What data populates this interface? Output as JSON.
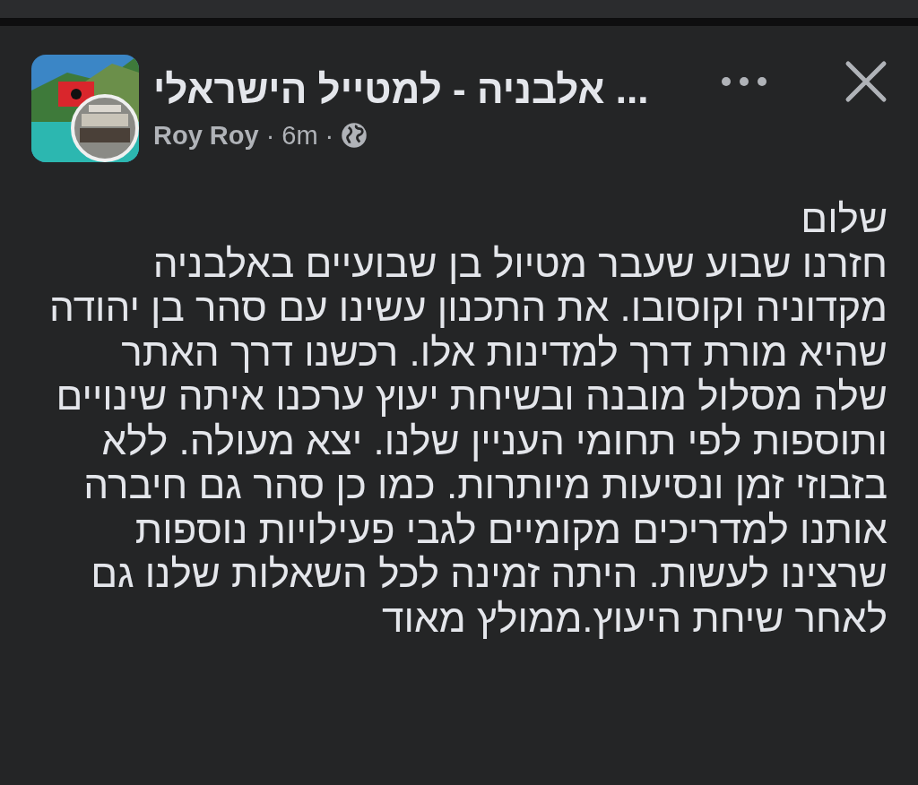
{
  "post": {
    "group_title": "... אלבניה - למטייל הישראלי",
    "author": "Roy Roy",
    "separator_1": "·",
    "time": "6m",
    "separator_2": "·"
  },
  "body_lines": [
    "שלום",
    "חזרנו שבוע שעבר מטיול בן שבועיים באלבניה",
    "מקדוניה וקוסובו. את התכנון עשינו עם סהר בן יהודה",
    "שהיא מורת דרך למדינות אלו. רכשנו דרך האתר",
    "שלה מסלול מובנה ובשיחת יעוץ ערכנו איתה שינויים",
    "ותוספות לפי תחומי העניין שלנו. יצא מעולה. ללא",
    "בזבוזי זמן ונסיעות מיותרות. כמו כן סהר גם חיברה",
    "אותנו למדריכים מקומיים לגבי פעילויות נוספות",
    "שרצינו לעשות. היתה זמינה לכל השאלות שלנו גם",
    "לאחר שיחת היעוץ.ממולץ מאוד"
  ]
}
